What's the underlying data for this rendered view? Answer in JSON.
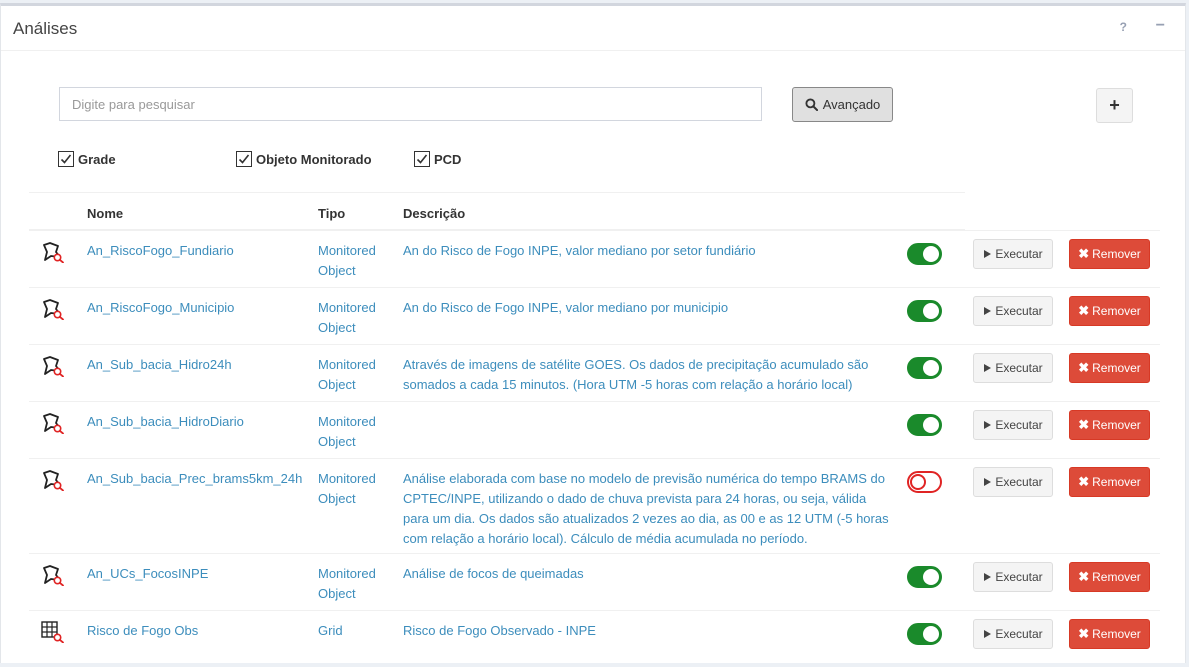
{
  "panel": {
    "title": "Análises",
    "help_label": "?",
    "collapse_label": "−"
  },
  "search": {
    "placeholder": "Digite para pesquisar",
    "advanced_label": "Avançado",
    "add_label": "+"
  },
  "filters": [
    {
      "label": "Grade",
      "checked": true
    },
    {
      "label": "Objeto Monitorado",
      "checked": true
    },
    {
      "label": "PCD",
      "checked": true
    }
  ],
  "table": {
    "columns": [
      "Nome",
      "Tipo",
      "Descrição"
    ],
    "execute_label": "Executar",
    "remove_label": "Remover",
    "rows": [
      {
        "icon": "monitored-object-search-icon",
        "name": "An_RiscoFogo_Fundiario",
        "type": "Monitored Object",
        "description": "An do Risco de Fogo INPE, valor mediano por setor fundiário",
        "active": true
      },
      {
        "icon": "monitored-object-search-icon",
        "name": "An_RiscoFogo_Municipio",
        "type": "Monitored Object",
        "description": "An do Risco de Fogo INPE, valor mediano por municipio",
        "active": true
      },
      {
        "icon": "monitored-object-search-icon",
        "name": "An_Sub_bacia_Hidro24h",
        "type": "Monitored Object",
        "description": "Através de imagens de satélite GOES. Os dados de precipitação acumulado são somados a cada 15 minutos. (Hora UTM -5 horas com relação a horário local)",
        "active": true
      },
      {
        "icon": "monitored-object-search-icon",
        "name": "An_Sub_bacia_HidroDiario",
        "type": "Monitored Object",
        "description": "",
        "active": true
      },
      {
        "icon": "monitored-object-search-icon",
        "name": "An_Sub_bacia_Prec_brams5km_24h",
        "type": "Monitored Object",
        "description": "Análise elaborada com base no modelo de previsão numérica do tempo BRAMS do CPTEC/INPE, utilizando o dado de chuva prevista para 24 horas, ou seja, válida para um dia. Os dados são atualizados 2 vezes ao dia, as 00 e as 12 UTM (-5 horas com relação a horário local). Cálculo de média acumulada no período.",
        "active": false
      },
      {
        "icon": "monitored-object-search-icon",
        "name": "An_UCs_FocosINPE",
        "type": "Monitored Object",
        "description": "Análise de focos de queimadas",
        "active": true
      },
      {
        "icon": "grid-search-icon",
        "name": "Risco de Fogo Obs",
        "type": "Grid",
        "description": "Risco de Fogo Observado - INPE",
        "active": true
      }
    ]
  },
  "colors": {
    "link": "#3c8dbc",
    "toggle_on": "#1a8a2b",
    "toggle_off": "#e02424",
    "remove_button": "#dd4b39"
  }
}
